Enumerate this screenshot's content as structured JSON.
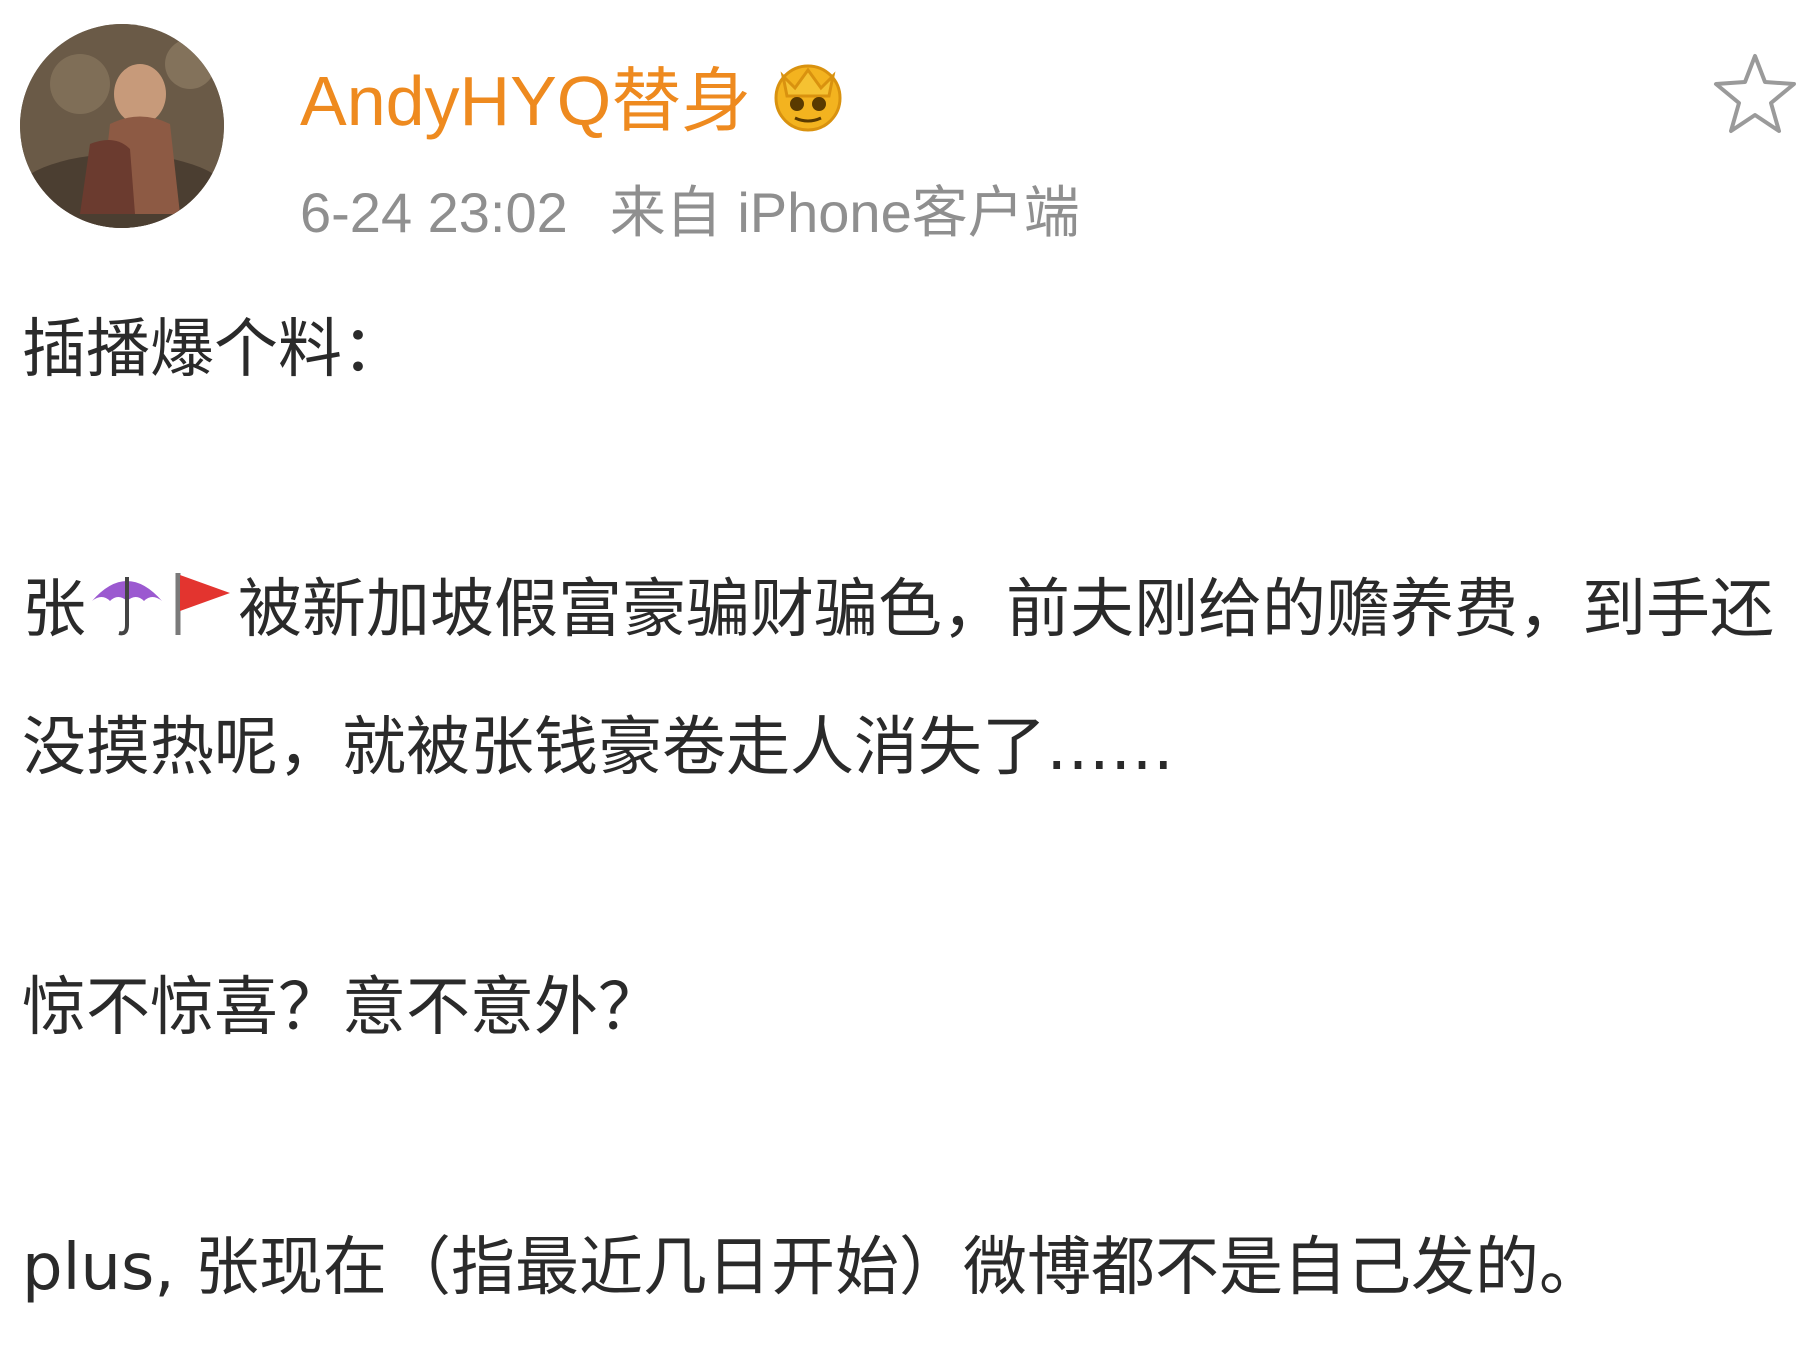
{
  "post": {
    "username": "AndyHYQ替身",
    "timestamp": "6-24 23:02",
    "source": "来自 iPhone客户端",
    "paragraphs": {
      "p1": "插播爆个料：",
      "p2_prefix": "张",
      "p2_body": "被新加坡假富豪骗财骗色，前夫刚给的赡养费，到手还没摸热呢，就被张钱豪卷走人消失了……",
      "p3": "惊不惊喜？意不意外？",
      "p4": "plus, 张现在（指最近几日开始）微博都不是自己发的。"
    }
  },
  "icons": {
    "avatar": "user-avatar-photo",
    "badge": "vip-crown-badge-icon",
    "favorite": "star-outline-icon",
    "emoji1": "umbrella-emoji-icon",
    "emoji2": "red-flag-emoji-icon"
  },
  "colors": {
    "username": "#ee8a1f",
    "meta": "#8f8f8f",
    "text": "#2a2a2a"
  }
}
